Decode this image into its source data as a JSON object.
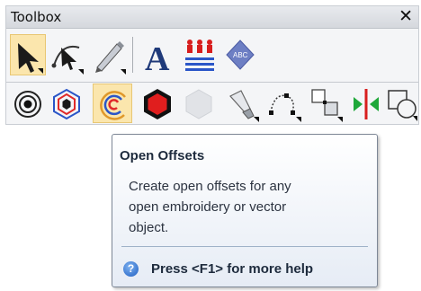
{
  "window": {
    "title": "Toolbox",
    "close_glyph": "✕"
  },
  "toolbar": {
    "row1": [
      {
        "name": "select-arrow-icon",
        "selected": true
      },
      {
        "name": "reshape-arrow-icon",
        "selected": false
      },
      {
        "name": "pen-digitize-icon",
        "selected": false
      },
      {
        "name": "text-lettering-icon",
        "label": "A",
        "selected": false
      },
      {
        "name": "team-names-icon",
        "selected": false
      },
      {
        "name": "monogram-icon",
        "label": "ABC",
        "selected": false
      }
    ],
    "row2": [
      {
        "name": "concentric-circles-icon",
        "selected": false
      },
      {
        "name": "hexagon-offsets-icon",
        "selected": false
      },
      {
        "name": "open-offsets-icon",
        "selected": true
      },
      {
        "name": "filled-hexagon-icon",
        "selected": false
      },
      {
        "name": "gray-hexagon-icon",
        "selected": false
      },
      {
        "name": "knife-icon",
        "selected": false
      },
      {
        "name": "reshape-nodes-icon",
        "selected": false
      },
      {
        "name": "align-icon",
        "selected": false
      },
      {
        "name": "mirror-icon",
        "selected": false
      },
      {
        "name": "weld-shapes-icon",
        "selected": false
      }
    ]
  },
  "tooltip": {
    "title": "Open Offsets",
    "description": "Create open offsets for any\nopen embroidery or vector\nobject.",
    "help_text": "Press <F1> for more help",
    "help_icon_glyph": "?"
  },
  "colors": {
    "selected_bg": "#fbe6ad",
    "accent_blue": "#1f5fc2",
    "accent_red": "#d81e1e"
  }
}
